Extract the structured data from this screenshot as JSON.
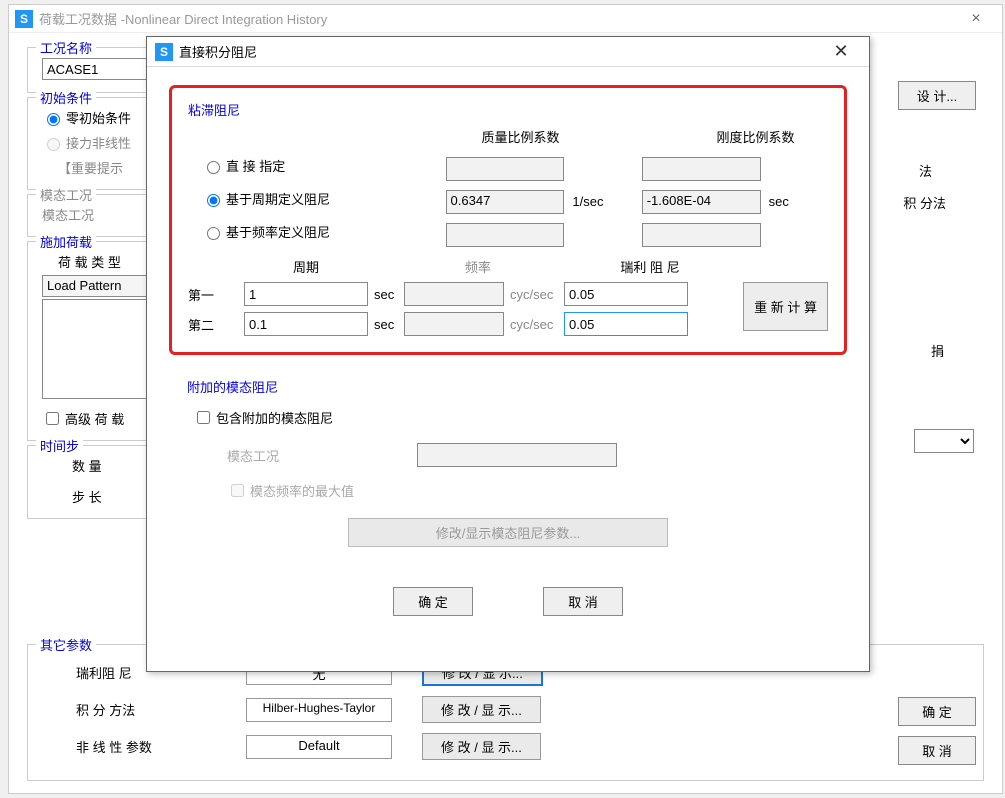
{
  "main_window": {
    "title": "荷载工况数据 -Nonlinear Direct Integration History",
    "groups": {
      "case_name": {
        "title": "工况名称",
        "value": "ACASE1"
      },
      "initial": {
        "title": "初始条件",
        "opt_zero": "零初始条件",
        "opt_nonlinear": "接力非线性",
        "hint": "【重要提示"
      },
      "modal_case": {
        "title": "模态工况",
        "label": "模态工况"
      },
      "apply_load": {
        "title": "施加荷载",
        "load_type_label": "荷 载 类 型",
        "load_pattern": "Load Pattern",
        "advanced": "高级 荷 载"
      },
      "time_step": {
        "title": "时间步",
        "count": "数 量",
        "step": "步 长"
      },
      "other": {
        "title": "其它参数",
        "rayleigh": "瑞利阻 尼",
        "rayleigh_val": "无",
        "integration": "积 分 方法",
        "integration_val": "Hilber-Hughes-Taylor",
        "nonlinear": "非 线 性 参数",
        "nonlinear_val": "Default",
        "modify_show": "修 改 / 显 示...",
        "modify_show_blue": "修 改 / 显 示..."
      }
    },
    "right_label_1": "法",
    "right_label_2": "积 分法",
    "right_label_3": "捐",
    "design_btn": "设 计...",
    "ok": "确 定",
    "cancel": "取 消"
  },
  "dialog": {
    "title": "直接积分阻尼",
    "viscous": {
      "title": "粘滞阻尼",
      "mass_coef": "质量比例系数",
      "stiff_coef": "刚度比例系数",
      "opt_direct": "直 接 指定",
      "opt_period": "基于周期定义阻尼",
      "opt_freq": "基于频率定义阻尼",
      "mass_val": "0.6347",
      "mass_unit": "1/sec",
      "stiff_val": "-1.608E-04",
      "stiff_unit": "sec",
      "period_hdr": "周期",
      "freq_hdr": "频率",
      "rayleigh_hdr": "瑞利 阻 尼",
      "first": "第一",
      "second": "第二",
      "p1": "1",
      "p2": "0.1",
      "unit_sec": "sec",
      "unit_cyc": "cyc/sec",
      "r1": "0.05",
      "r2": "0.05",
      "recalc": "重 新 计 算"
    },
    "addl_modal": {
      "title": "附加的模态阻尼",
      "include": "包含附加的模态阻尼",
      "modal_case": "模态工况",
      "max_freq": "模态频率的最大值",
      "modify_show": "修改/显示模态阻尼参数..."
    },
    "ok": "确 定",
    "cancel": "取 消"
  }
}
